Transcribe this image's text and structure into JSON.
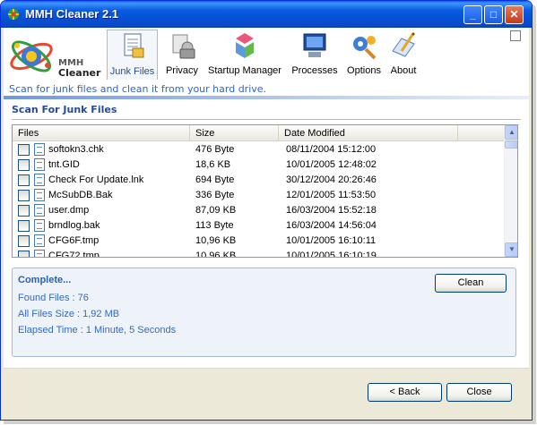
{
  "window": {
    "title": "MMH Cleaner 2.1"
  },
  "title_buttons": {
    "minimize": "_",
    "maximize": "□",
    "close": "✕"
  },
  "logo": {
    "line1": "MMH",
    "line2": "Cleaner"
  },
  "tabs": [
    {
      "label": "Junk Files",
      "icon": "junk-files-icon",
      "active": true
    },
    {
      "label": "Privacy",
      "icon": "privacy-icon",
      "active": false
    },
    {
      "label": "Startup Manager",
      "icon": "startup-manager-icon",
      "active": false
    },
    {
      "label": "Processes",
      "icon": "processes-icon",
      "active": false
    },
    {
      "label": "Options",
      "icon": "options-icon",
      "active": false
    },
    {
      "label": "About",
      "icon": "about-icon",
      "active": false
    }
  ],
  "description": "Scan for junk files and clean it from your hard drive.",
  "section_title": "Scan For Junk Files",
  "list": {
    "columns": [
      "Files",
      "Size",
      "Date Modified"
    ],
    "rows": [
      {
        "file": "softokn3.chk",
        "size": "476 Byte",
        "date": "08/11/2004 15:12:00"
      },
      {
        "file": "tnt.GID",
        "size": "18,6 KB",
        "date": "10/01/2005 12:48:02"
      },
      {
        "file": "Check For Update.lnk",
        "size": "694 Byte",
        "date": "30/12/2004 20:26:46"
      },
      {
        "file": "McSubDB.Bak",
        "size": "336 Byte",
        "date": "12/01/2005 11:53:50"
      },
      {
        "file": "user.dmp",
        "size": "87,09 KB",
        "date": "16/03/2004 15:52:18"
      },
      {
        "file": "brndlog.bak",
        "size": "113 Byte",
        "date": "16/03/2004 14:56:04"
      },
      {
        "file": "CFG6F.tmp",
        "size": "10,96 KB",
        "date": "10/01/2005 16:10:11"
      },
      {
        "file": "CFG72.tmp",
        "size": "10,96 KB",
        "date": "10/01/2005 16:10:19"
      }
    ]
  },
  "status": {
    "state": "Complete...",
    "found_files": "Found Files : 76",
    "all_files_size": "All Files Size : 1,92 MB",
    "elapsed_time": "Elapsed Time : 1 Minute, 5 Seconds"
  },
  "buttons": {
    "clean": "Clean",
    "back": "< Back",
    "close": "Close"
  },
  "colors": {
    "accent": "#3064c8",
    "title_bar": "#0553d6"
  }
}
